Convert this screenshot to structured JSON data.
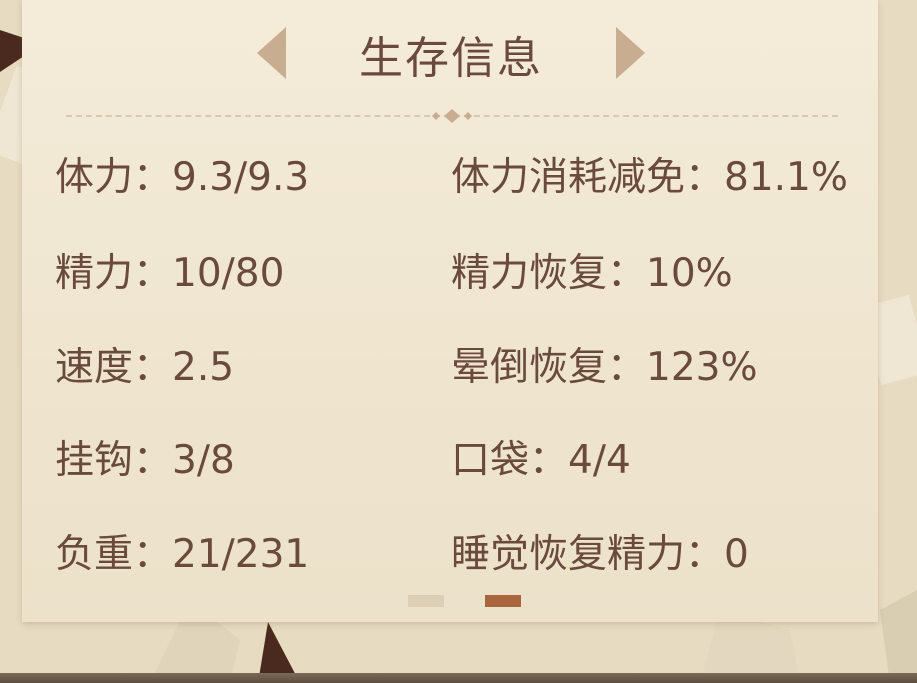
{
  "panel": {
    "title": "生存信息",
    "pager_active": 2
  },
  "stats": {
    "left": [
      {
        "label": "体力：",
        "value": "9.3/9.3"
      },
      {
        "label": "精力：",
        "value": "10/80"
      },
      {
        "label": "速度：",
        "value": "2.5"
      },
      {
        "label": "挂钩：",
        "value": "3/8"
      },
      {
        "label": "负重：",
        "value": "21/231"
      }
    ],
    "right": [
      {
        "label": "体力消耗减免：",
        "value": "81.1%"
      },
      {
        "label": "精力恢复：",
        "value": "10%"
      },
      {
        "label": "晕倒恢复：",
        "value": "123%"
      },
      {
        "label": "口袋：",
        "value": "4/4"
      },
      {
        "label": "睡觉恢复精力：",
        "value": "0"
      }
    ]
  },
  "colors": {
    "text": "#6b4a3e",
    "arrow": "#c9ad90",
    "pager_active": "#a8653e",
    "pager_inactive": "#dccfb6"
  }
}
